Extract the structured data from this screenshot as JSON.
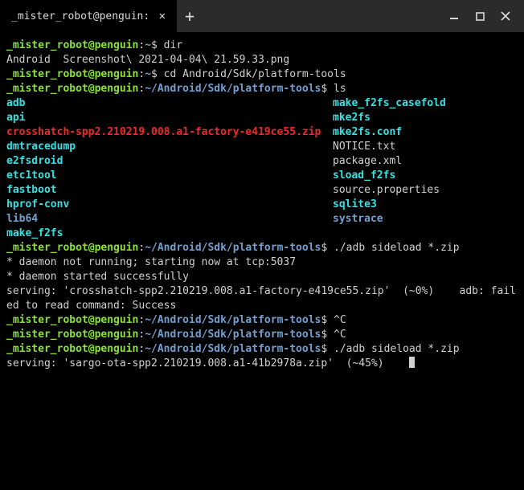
{
  "titlebar": {
    "tab_title": "_mister_robot@penguin: ~/Android/Sdk/platform-tools"
  },
  "colors": {
    "prompt_green": "#8ae234",
    "path_blue": "#729fcf",
    "cyan": "#34e2e2",
    "red": "#ef2929",
    "fg": "#d0d0d0",
    "bg": "#000000",
    "chrome": "#2b2b2b"
  },
  "prompt_user_host": "_mister_robot@penguin",
  "home_prompt_path": "~",
  "tools_prompt_path": "~/Android/Sdk/platform-tools",
  "cmds": {
    "dir": "dir",
    "cd": "cd Android/Sdk/platform-tools",
    "ls": "ls",
    "sideload": "./adb sideload *.zip",
    "ctrlc": "^C"
  },
  "dir_output": "Android  Screenshot\\ 2021-04-04\\ 21.59.33.png",
  "ls_listing": {
    "col1": [
      {
        "name": "adb",
        "cls": "c"
      },
      {
        "name": "api",
        "cls": "c"
      },
      {
        "name": "crosshatch-spp2.210219.008.a1-factory-e419ce55.zip",
        "cls": "r"
      },
      {
        "name": "dmtracedump",
        "cls": "c"
      },
      {
        "name": "e2fsdroid",
        "cls": "c"
      },
      {
        "name": "etc1tool",
        "cls": "c"
      },
      {
        "name": "fastboot",
        "cls": "c"
      },
      {
        "name": "hprof-conv",
        "cls": "c"
      },
      {
        "name": "lib64",
        "cls": "b"
      },
      {
        "name": "make_f2fs",
        "cls": "c"
      }
    ],
    "col2": [
      {
        "name": "make_f2fs_casefold",
        "cls": "c"
      },
      {
        "name": "mke2fs",
        "cls": "c"
      },
      {
        "name": "mke2fs.conf",
        "cls": "c"
      },
      {
        "name": "NOTICE.txt",
        "cls": "w"
      },
      {
        "name": "package.xml",
        "cls": "w"
      },
      {
        "name": "sload_f2fs",
        "cls": "c"
      },
      {
        "name": "source.properties",
        "cls": "w"
      },
      {
        "name": "sqlite3",
        "cls": "c"
      },
      {
        "name": "systrace",
        "cls": "b"
      }
    ]
  },
  "sideload1_output": [
    "* daemon not running; starting now at tcp:5037",
    "* daemon started successfully",
    "serving: 'crosshatch-spp2.210219.008.a1-factory-e419ce55.zip'  (~0%)    adb: fail",
    "ed to read command: Success"
  ],
  "sideload2_line": "serving: 'sargo-ota-spp2.210219.008.a1-41b2978a.zip'  (~45%)    "
}
